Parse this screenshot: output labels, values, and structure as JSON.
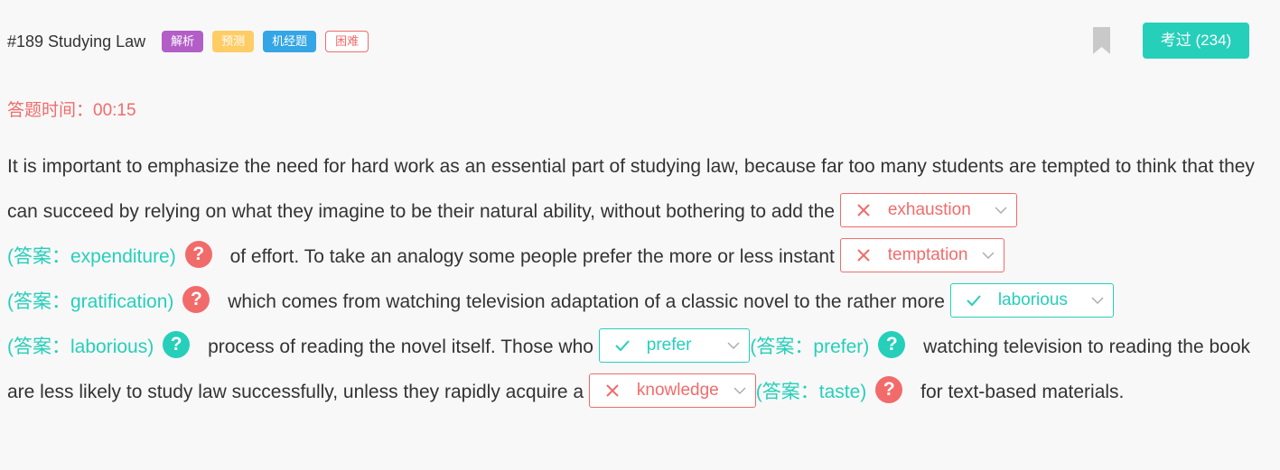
{
  "header": {
    "title": "#189 Studying Law",
    "tags": [
      "解析",
      "预测",
      "机经题",
      "困难"
    ],
    "exam_button": "考过 (234)"
  },
  "timer": {
    "label": "答题时间：",
    "value": "00:15"
  },
  "passage": {
    "t1": "It is important to emphasize the need for hard work as an essential part of studying law, because far too many students are tempted to think that they can succeed by relying on what they imagine to be their natural ability, without bothering to add the",
    "t2": "of effort. To take an analogy some people prefer the more or less instant",
    "t3": "which comes from watching television adaptation of a classic novel to the rather more",
    "t4": "process of reading the novel itself. Those who",
    "t5": "watching television to reading the book are less likely to study law successfully, unless they rapidly acquire a",
    "t6": "for text-based materials.",
    "blanks": [
      {
        "selected": "exhaustion",
        "answer": "(答案：expenditure)",
        "status": "wrong"
      },
      {
        "selected": "temptation",
        "answer": "(答案：gratification)",
        "status": "wrong"
      },
      {
        "selected": "laborious",
        "answer": "(答案：laborious)",
        "status": "correct"
      },
      {
        "selected": "prefer",
        "answer": "(答案：prefer)",
        "status": "correct"
      },
      {
        "selected": "knowledge",
        "answer": "(答案：taste)",
        "status": "wrong"
      }
    ]
  },
  "help_glyph": "?",
  "colors": {
    "accent": "#26cfba",
    "error": "#f26b6b",
    "tag_purple": "#b35ec7",
    "tag_yellow": "#ffcc66",
    "tag_blue": "#34a5e5"
  }
}
